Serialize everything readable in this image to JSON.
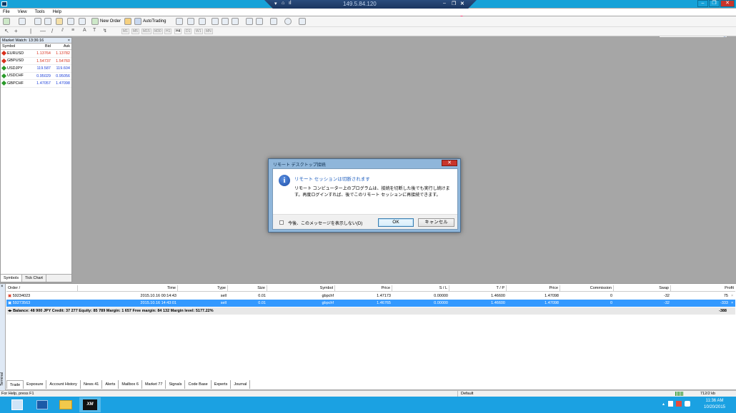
{
  "titlebar": {
    "window_buttons": [
      "–",
      "❐",
      "✕"
    ]
  },
  "rdp_bar": {
    "ip": "149.5.84.120",
    "buttons": [
      "▾",
      "⌂",
      "ıl",
      "–",
      "❐",
      "✕"
    ]
  },
  "menu": [
    "File",
    "View",
    "Tools",
    "Help"
  ],
  "toolbar": {
    "new_order": "New Order",
    "autotrading": "AutoTrading"
  },
  "timeframes": [
    "M1",
    "M5",
    "M15",
    "M30",
    "H1",
    "H4",
    "D1",
    "W1",
    "MN"
  ],
  "market_watch": {
    "title": "Market Watch: 13:36:16",
    "close": "×",
    "headers": {
      "symbol": "Symbol",
      "bid": "Bid",
      "ask": "Ask"
    },
    "rows": [
      {
        "symbol": "EURUSD",
        "bid": "1.13764",
        "ask": "1.13782",
        "color": "#d9301c",
        "dir": "down"
      },
      {
        "symbol": "GBPUSD",
        "bid": "1.54737",
        "ask": "1.54760",
        "color": "#d9301c",
        "dir": "down"
      },
      {
        "symbol": "USDJPY",
        "bid": "119.587",
        "ask": "119.604",
        "color": "#1c3fd9",
        "dir": "up"
      },
      {
        "symbol": "USDCHF",
        "bid": "0.95029",
        "ask": "0.95056",
        "color": "#1c3fd9",
        "dir": "up"
      },
      {
        "symbol": "GBPCHF",
        "bid": "1.47057",
        "ask": "1.47098",
        "color": "#1c3fd9",
        "dir": "up"
      }
    ],
    "tabs": [
      "Symbols",
      "Tick Chart"
    ]
  },
  "dialog": {
    "title": "リモート デスクトップ接続",
    "close": "✕",
    "heading": "リモート セッションは切断されます",
    "message": "リモート コンピューター上のプログラムは、接続を切断した後でも実行し続けます。再度ログインすれば、後でこのリモート セッションに再接続できます。",
    "checkbox_label": "今後、このメッセージを表示しない(D)",
    "ok": "OK",
    "cancel": "キャンセル"
  },
  "terminal": {
    "side_close": "×",
    "side_label": "Terminal",
    "headers": [
      "Order  /",
      "Time",
      "Type",
      "Size",
      "Symbol",
      "Price",
      "S / L",
      "T / P",
      "Price",
      "Commission",
      "Swap",
      "Profit"
    ],
    "rows": [
      {
        "order": "59234023",
        "time": "2015.10.16 00:14:43",
        "type": "sell",
        "size": "0.01",
        "symbol": "gbpchf",
        "price": "1.47173",
        "sl": "0.00000",
        "tp": "1.46600",
        "cur_price": "1.47098",
        "commission": "0",
        "swap": "-32",
        "profit": "75",
        "x": "×"
      },
      {
        "order": "59273563",
        "time": "2015.10.16 14:43:01",
        "type": "sell",
        "size": "0.01",
        "symbol": "gbpchf",
        "price": "1.46765",
        "sl": "0.00000",
        "tp": "1.46600",
        "cur_price": "1.47098",
        "commission": "0",
        "swap": "-32",
        "profit": "-333",
        "x": "×"
      }
    ],
    "balance_line": "Balance: 48 900 JPY  Credit: 37 277  Equity: 85 789  Margin: 1 657  Free margin: 84 132  Margin level: 5177.22%",
    "balance_profit": "-388",
    "tabs": [
      "Trade",
      "Exposure",
      "Account History",
      "News 41",
      "Alerts",
      "Mailbox 6",
      "Market 77",
      "Signals",
      "Code Base",
      "Experts",
      "Journal"
    ]
  },
  "status": {
    "help": "For Help, press F1",
    "profile": "Default",
    "traffic": "712/2 kb"
  },
  "taskbar": {
    "time": "11:36 AM",
    "date": "10/20/2015",
    "xm_label": "XM"
  }
}
